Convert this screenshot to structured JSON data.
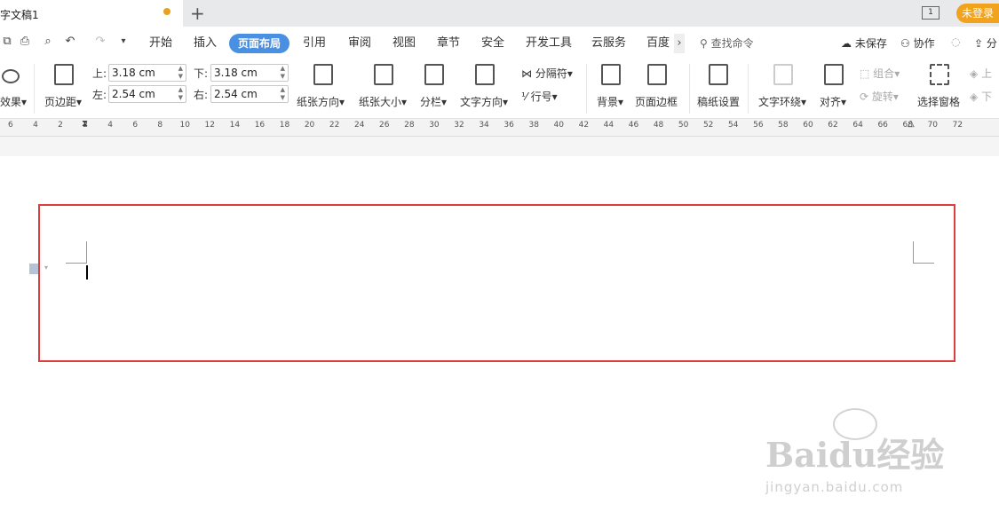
{
  "tab": {
    "title": "字文稿1"
  },
  "window": {
    "page_indicator": "1",
    "login": "未登录"
  },
  "menu": {
    "items": [
      "开始",
      "插入",
      "页面布局",
      "引用",
      "审阅",
      "视图",
      "章节",
      "安全",
      "开发工具",
      "云服务",
      "百度"
    ],
    "active": "页面布局",
    "search": "查找命令",
    "unsaved": "未保存",
    "collab": "协作",
    "share": "分"
  },
  "ribbon": {
    "effects": "效果",
    "margins": "页边距",
    "top_label": "上:",
    "top_value": "3.18 cm",
    "bottom_label": "下:",
    "bottom_value": "3.18 cm",
    "left_label": "左:",
    "left_value": "2.54 cm",
    "right_label": "右:",
    "right_value": "2.54 cm",
    "orientation": "纸张方向",
    "size": "纸张大小",
    "columns": "分栏",
    "text_direction": "文字方向",
    "breaks": "分隔符",
    "line_numbers": "行号",
    "background": "背景",
    "page_border": "页面边框",
    "manuscript": "稿纸设置",
    "text_wrap": "文字环绕",
    "align": "对齐",
    "group": "组合",
    "rotate": "旋转",
    "selection_pane": "选择窗格",
    "bring_forward": "上",
    "send_backward": "下"
  },
  "ruler": {
    "ticks": [
      "6",
      "4",
      "2",
      "2",
      "4",
      "6",
      "8",
      "10",
      "12",
      "14",
      "16",
      "18",
      "20",
      "22",
      "24",
      "26",
      "28",
      "30",
      "32",
      "34",
      "36",
      "38",
      "40",
      "42",
      "44",
      "46",
      "48",
      "50",
      "52",
      "54",
      "56",
      "58",
      "60",
      "62",
      "64",
      "66",
      "68",
      "70",
      "72"
    ]
  },
  "watermark": {
    "brand": "Baidu经验",
    "url": "jingyan.baidu.com"
  },
  "colors": {
    "accent": "#4a90e2",
    "highlight": "#e03c3c",
    "login": "#f2a31d"
  }
}
